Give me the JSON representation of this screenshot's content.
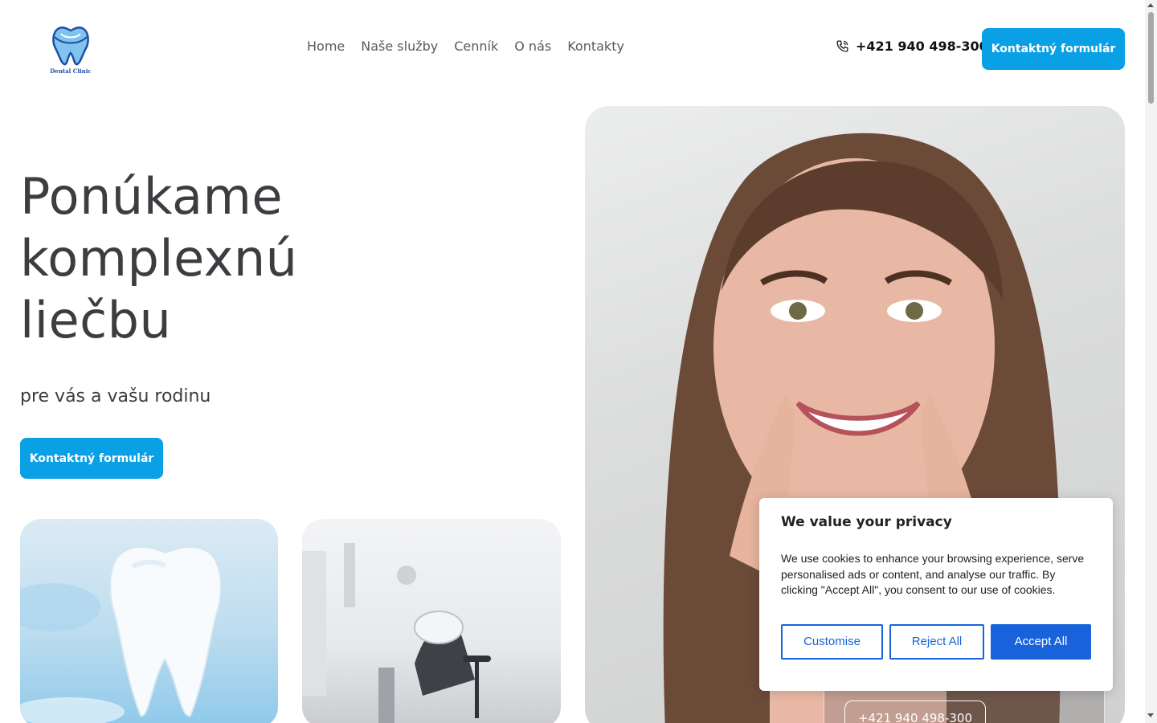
{
  "brand": {
    "logo_text": "Dental Clinic",
    "accent_color": "#0aa0e6"
  },
  "nav": {
    "items": [
      "Home",
      "Naše služby",
      "Cenník",
      "O nás",
      "Kontakty"
    ]
  },
  "header": {
    "phone": "+421 940 498-300",
    "cta_label": "Kontaktný formulár",
    "phone_icon": "phone-icon"
  },
  "hero": {
    "title_lines": [
      "Ponúkame",
      "komplexnú",
      "liečbu"
    ],
    "subtitle": "pre vás a vašu rodinu",
    "cta_label": "Kontaktný formulár"
  },
  "peek": {
    "phone_button": "+421 940 498-300"
  },
  "cookie": {
    "title": "We value your privacy",
    "text": "We use cookies to enhance your browsing experience, serve personalised ads or content, and analyse our traffic. By clicking \"Accept All\", you consent to our use of cookies.",
    "customise_label": "Customise",
    "reject_label": "Reject All",
    "accept_label": "Accept All",
    "button_color": "#1863dc"
  }
}
